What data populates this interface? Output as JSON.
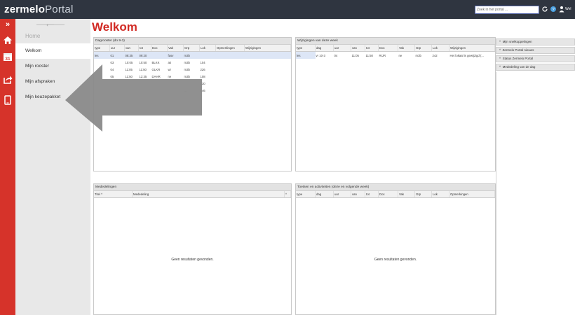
{
  "app": {
    "logo_bold": "zermelo",
    "logo_light": "Portal",
    "user_label": "Wel"
  },
  "search": {
    "placeholder": "Zoek in het portal ..."
  },
  "nav": {
    "home": "Home",
    "items": [
      {
        "label": "Welkom"
      },
      {
        "label": "Mijn rooster"
      },
      {
        "label": "Mijn afspraken"
      },
      {
        "label": "Mijn keuzepakket"
      }
    ]
  },
  "iconbar": {
    "calendar_day": "31"
  },
  "page": {
    "title": "Welkom"
  },
  "dagrooster": {
    "title": "Dagrooster (do 9-3)",
    "columns": [
      "type",
      "uur",
      "van",
      "tot",
      "Doc",
      "Vak",
      "Grp",
      "Lok",
      "Opmerkingen",
      "Wijzigingen"
    ],
    "rows": [
      [
        "les",
        "01",
        "08:35",
        "09:20",
        "",
        "fasv",
        "m3b",
        "",
        "",
        ""
      ],
      [
        "",
        "03",
        "10:05",
        "10:50",
        "BLKK",
        "ak",
        "m3b",
        "104",
        "",
        ""
      ],
      [
        "",
        "04",
        "11:05",
        "11:50",
        "GLKR",
        "wi",
        "m3b",
        "226",
        "",
        ""
      ],
      [
        "",
        "05",
        "11:50",
        "12:35",
        "DAHR",
        "ne",
        "m3b",
        "108",
        "",
        ""
      ],
      [
        "",
        "",
        "",
        "",
        "",
        "",
        "",
        "130",
        "",
        ""
      ],
      [
        "",
        "",
        "",
        "",
        "",
        "",
        "...",
        "146",
        "",
        ""
      ]
    ]
  },
  "wijzigingen": {
    "title": "Wijzigingen van deze week",
    "columns": [
      "type",
      "dag",
      "uur",
      "van",
      "tot",
      "Doc",
      "Vak",
      "Grp",
      "Lok",
      "Wijzigingen"
    ],
    "rows": [
      [
        "les",
        "vr 10-3",
        "04",
        "11:05",
        "11:50",
        "RIJR",
        "ne",
        "m3b",
        "242",
        "Het lokaal is gewijzigd (..."
      ]
    ]
  },
  "mededelingen": {
    "title": "Mededelingen",
    "columns": [
      "Titel ^",
      "Mededeling"
    ],
    "empty": "Geen resultaten gevonden."
  },
  "toetsen": {
    "title": "Toetsen en activiteiten (deze en volgende week)",
    "columns": [
      "type",
      "dag",
      "uur",
      "van",
      "tot",
      "Doc",
      "Vak",
      "Grp",
      "Lok",
      "Opmerkingen"
    ],
    "empty": "Geen resultaten gevonden."
  },
  "sidebar": {
    "sections": [
      {
        "label": "Mijn snelkoppelingen"
      },
      {
        "label": "Zermelo Portal nieuws"
      },
      {
        "label": "Status Zermelo Portal"
      },
      {
        "label": "Mededeling van de dag"
      }
    ]
  },
  "colors": {
    "topbar": "#2f3540",
    "accent_red": "#d6332a",
    "title_red": "#d12a24",
    "arrow": "#8a8a8a"
  }
}
